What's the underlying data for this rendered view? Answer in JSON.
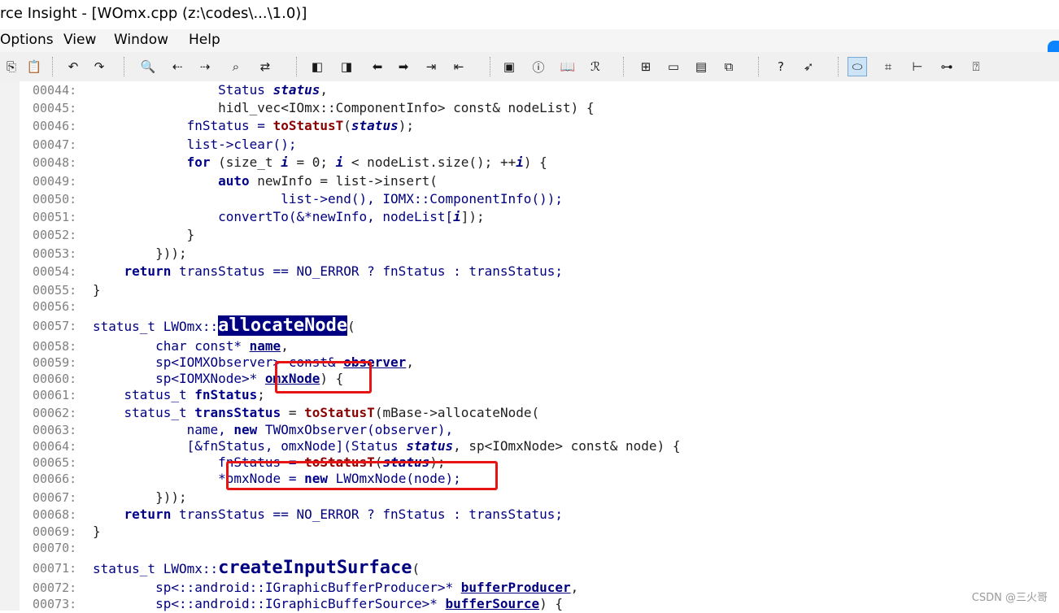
{
  "window": {
    "title": "rce Insight - [WOmx.cpp (z:\\codes\\...\\1.0)]"
  },
  "menu": [
    "Options",
    "View",
    "Window",
    "Help"
  ],
  "toolbar_icons": [
    "paste-icon",
    "clipboard-icon",
    "undo-icon",
    "redo-icon",
    "search-icon",
    "search-prev-icon",
    "search-next-icon",
    "search-files-icon",
    "replace-icon",
    "bookmark-prev-icon",
    "bookmark-next-icon",
    "back-icon",
    "forward-icon",
    "jump-in-icon",
    "jump-out-icon",
    "project-icon",
    "symbol-info-icon",
    "book-icon",
    "lookup-icon",
    "layout-1-icon",
    "layout-2-icon",
    "layout-3-icon",
    "layout-4-icon",
    "help-symbol-icon",
    "pointer-help-icon",
    "view-1-icon",
    "view-2-icon",
    "tree-icon",
    "relation-icon",
    "browse-icon"
  ],
  "code_lines": [
    {
      "n": "00044:",
      "segments": [
        {
          "t": "                Status ",
          "c": "ty"
        },
        {
          "t": "status",
          "c": "param"
        },
        {
          "t": ",",
          "c": ""
        }
      ]
    },
    {
      "n": "00045:",
      "segments": [
        {
          "t": "                hidl_vec<IOmx::ComponentInfo> const& nodeList) {",
          "c": ""
        }
      ]
    },
    {
      "n": "00046:",
      "segments": [
        {
          "t": "            fnStatus = ",
          "c": "ty"
        },
        {
          "t": "toStatusT",
          "c": "fn"
        },
        {
          "t": "(",
          "c": ""
        },
        {
          "t": "status",
          "c": "param"
        },
        {
          "t": ");",
          "c": ""
        }
      ]
    },
    {
      "n": "00047:",
      "segments": [
        {
          "t": "            list->clear();",
          "c": "ty"
        }
      ]
    },
    {
      "n": "00048:",
      "segments": [
        {
          "t": "            ",
          "c": ""
        },
        {
          "t": "for",
          "c": "kw"
        },
        {
          "t": " (size_t ",
          "c": ""
        },
        {
          "t": "i",
          "c": "param"
        },
        {
          "t": " = 0; ",
          "c": ""
        },
        {
          "t": "i",
          "c": "param"
        },
        {
          "t": " < nodeList.size(); ++",
          "c": ""
        },
        {
          "t": "i",
          "c": "param"
        },
        {
          "t": ") {",
          "c": ""
        }
      ]
    },
    {
      "n": "00049:",
      "segments": [
        {
          "t": "                ",
          "c": ""
        },
        {
          "t": "auto",
          "c": "kw"
        },
        {
          "t": " newInfo = list->insert(",
          "c": ""
        }
      ]
    },
    {
      "n": "00050:",
      "segments": [
        {
          "t": "                        list->end(), IOMX::ComponentInfo());",
          "c": "ty"
        }
      ]
    },
    {
      "n": "00051:",
      "segments": [
        {
          "t": "                convertTo(&*newInfo, nodeList[",
          "c": "ty"
        },
        {
          "t": "i",
          "c": "param"
        },
        {
          "t": "]);",
          "c": ""
        }
      ]
    },
    {
      "n": "00052:",
      "segments": [
        {
          "t": "            }",
          "c": ""
        }
      ]
    },
    {
      "n": "00053:",
      "segments": [
        {
          "t": "        }));",
          "c": ""
        }
      ]
    },
    {
      "n": "00054:",
      "segments": [
        {
          "t": "    ",
          "c": ""
        },
        {
          "t": "return",
          "c": "kw"
        },
        {
          "t": " transStatus == NO_ERROR ? fnStatus : transStatus;",
          "c": "ty"
        }
      ]
    },
    {
      "n": "00055:",
      "segments": [
        {
          "t": "}",
          "c": ""
        }
      ]
    },
    {
      "n": "00056:",
      "segments": [
        {
          "t": "",
          "c": ""
        }
      ]
    },
    {
      "n": "00057:",
      "segments": [
        {
          "t": "status_t LWOmx::",
          "c": "ty"
        },
        {
          "t": "allocateNode",
          "c": "hl-decl"
        },
        {
          "t": "(",
          "c": ""
        }
      ]
    },
    {
      "n": "00058:",
      "segments": [
        {
          "t": "        char const* ",
          "c": "ty"
        },
        {
          "t": "name",
          "c": "ref"
        },
        {
          "t": ",",
          "c": ""
        }
      ]
    },
    {
      "n": "00059:",
      "segments": [
        {
          "t": "        sp<IOMXObserver> const& ",
          "c": "ty"
        },
        {
          "t": "observer",
          "c": "ref"
        },
        {
          "t": ",",
          "c": ""
        }
      ]
    },
    {
      "n": "00060:",
      "segments": [
        {
          "t": "        sp<IOMXNode>* ",
          "c": "ty"
        },
        {
          "t": "omxNode",
          "c": "ref"
        },
        {
          "t": ") {",
          "c": ""
        }
      ]
    },
    {
      "n": "00061:",
      "segments": [
        {
          "t": "    status_t ",
          "c": "ty"
        },
        {
          "t": "fnStatus",
          "c": "kw"
        },
        {
          "t": ";",
          "c": ""
        }
      ]
    },
    {
      "n": "00062:",
      "segments": [
        {
          "t": "    status_t ",
          "c": "ty"
        },
        {
          "t": "transStatus",
          "c": "kw"
        },
        {
          "t": " = ",
          "c": ""
        },
        {
          "t": "toStatusT",
          "c": "fn"
        },
        {
          "t": "(mBase->allocateNode(",
          "c": ""
        }
      ]
    },
    {
      "n": "00063:",
      "segments": [
        {
          "t": "            name, ",
          "c": "ty"
        },
        {
          "t": "new",
          "c": "kw"
        },
        {
          "t": " TWOmxObserver(observer),",
          "c": "ty"
        }
      ]
    },
    {
      "n": "00064:",
      "segments": [
        {
          "t": "            [&fnStatus, omxNode](Status ",
          "c": "ty"
        },
        {
          "t": "status",
          "c": "param"
        },
        {
          "t": ", sp<IOmxNode> const& node) {",
          "c": ""
        }
      ]
    },
    {
      "n": "00065:",
      "segments": [
        {
          "t": "                fnStatus = ",
          "c": "ty"
        },
        {
          "t": "toStatusT",
          "c": "fn"
        },
        {
          "t": "(",
          "c": ""
        },
        {
          "t": "status",
          "c": "param"
        },
        {
          "t": ");",
          "c": ""
        }
      ]
    },
    {
      "n": "00066:",
      "segments": [
        {
          "t": "                *omxNode = ",
          "c": "ty"
        },
        {
          "t": "new",
          "c": "kw"
        },
        {
          "t": " LWOmxNode(node);",
          "c": "ty"
        }
      ]
    },
    {
      "n": "00067:",
      "segments": [
        {
          "t": "        }));",
          "c": ""
        }
      ]
    },
    {
      "n": "00068:",
      "segments": [
        {
          "t": "    ",
          "c": ""
        },
        {
          "t": "return",
          "c": "kw"
        },
        {
          "t": " transStatus == NO_ERROR ? fnStatus : transStatus;",
          "c": "ty"
        }
      ]
    },
    {
      "n": "00069:",
      "segments": [
        {
          "t": "}",
          "c": ""
        }
      ]
    },
    {
      "n": "00070:",
      "segments": [
        {
          "t": "",
          "c": ""
        }
      ]
    },
    {
      "n": "00071:",
      "segments": [
        {
          "t": "status_t LWOmx::",
          "c": "ty"
        },
        {
          "t": "createInputSurface",
          "c": "decl"
        },
        {
          "t": "(",
          "c": ""
        }
      ]
    },
    {
      "n": "00072:",
      "segments": [
        {
          "t": "        sp<::android::IGraphicBufferProducer>* ",
          "c": "ty"
        },
        {
          "t": "bufferProducer",
          "c": "ref"
        },
        {
          "t": ",",
          "c": ""
        }
      ]
    },
    {
      "n": "00073:",
      "segments": [
        {
          "t": "        sp<::android::IGraphicBufferSource>* ",
          "c": "ty"
        },
        {
          "t": "bufferSource",
          "c": "ref"
        },
        {
          "t": ") {",
          "c": ""
        }
      ]
    }
  ],
  "watermark": "CSDN @三火哥"
}
